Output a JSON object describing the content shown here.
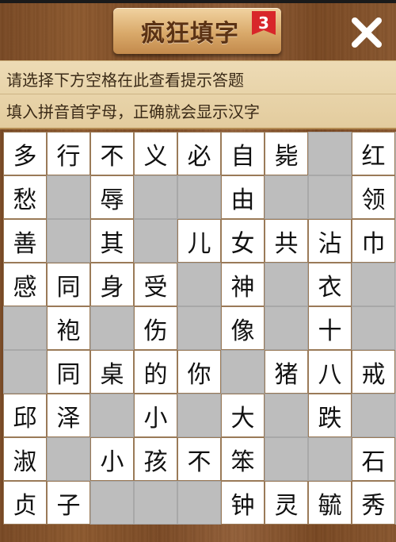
{
  "header": {
    "title": "疯狂填字",
    "level": "3",
    "close_icon": "close-icon"
  },
  "hint": {
    "line1": "请选择下方空格在此查看提示答题",
    "line2": "填入拼音首字母，正确就会显示汉字"
  },
  "grid": [
    [
      "多",
      "行",
      "不",
      "义",
      "必",
      "自",
      "毙",
      "",
      "红"
    ],
    [
      "愁",
      "",
      "辱",
      "",
      "",
      "由",
      "",
      "",
      "领"
    ],
    [
      "善",
      "",
      "其",
      "",
      "儿",
      "女",
      "共",
      "沾",
      "巾"
    ],
    [
      "感",
      "同",
      "身",
      "受",
      "",
      "神",
      "",
      "衣",
      ""
    ],
    [
      "",
      "袍",
      "",
      "伤",
      "",
      "像",
      "",
      "十",
      ""
    ],
    [
      "",
      "同",
      "桌",
      "的",
      "你",
      "",
      "猪",
      "八",
      "戒"
    ],
    [
      "邱",
      "泽",
      "",
      "小",
      "",
      "大",
      "",
      "跌",
      ""
    ],
    [
      "淑",
      "",
      "小",
      "孩",
      "不",
      "笨",
      "",
      "",
      "石"
    ],
    [
      "贞",
      "子",
      "",
      "",
      "",
      "钟",
      "灵",
      "毓",
      "秀"
    ]
  ]
}
